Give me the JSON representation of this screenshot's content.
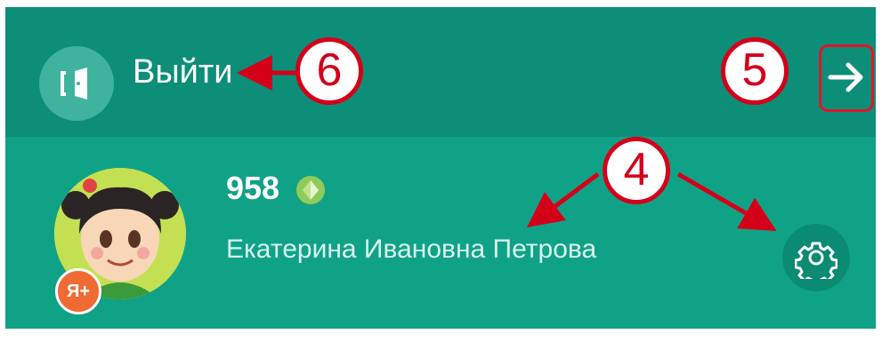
{
  "header": {
    "logout_label": "Выйти",
    "logout_icon": "door-exit-icon",
    "exit_icon": "arrow-right-icon"
  },
  "profile": {
    "points": "958",
    "points_icon": "gem-icon",
    "full_name": "Екатерина Ивановна Петрова",
    "avatar_badge": "Я+",
    "settings_icon": "gear-icon"
  },
  "callouts": {
    "four": "4",
    "five": "5",
    "six": "6"
  },
  "colors": {
    "header_bg": "#0d8e78",
    "profile_bg": "#10a287",
    "callout_red": "#d4001a",
    "badge_orange": "#f06a33"
  }
}
